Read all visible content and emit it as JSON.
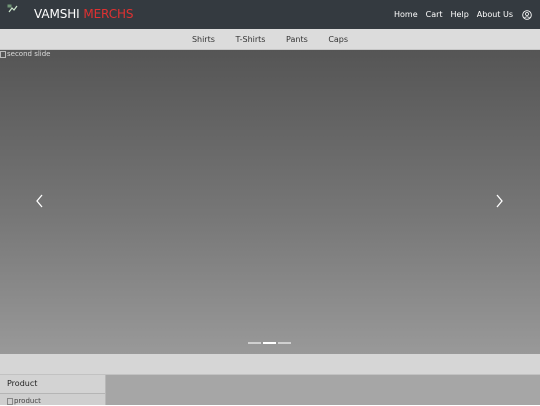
{
  "header": {
    "brand_primary": "VAMSHI",
    "brand_accent": "MERCHS",
    "nav": [
      {
        "label": "Home"
      },
      {
        "label": "Cart"
      },
      {
        "label": "Help"
      },
      {
        "label": "About Us"
      }
    ],
    "account_icon": "user-circle-icon",
    "logo_icon": "broken-image-icon"
  },
  "categories": [
    {
      "label": "Shirts"
    },
    {
      "label": "T-Shirts"
    },
    {
      "label": "Pants"
    },
    {
      "label": "Caps"
    }
  ],
  "carousel": {
    "slide_alt": "second slide",
    "active_index": 1,
    "slide_count": 3,
    "prev_icon": "chevron-left-icon",
    "next_icon": "chevron-right-icon"
  },
  "products": [
    {
      "header": "Product",
      "image_alt": "product"
    }
  ],
  "colors": {
    "navbar": "#343a40",
    "brand_accent": "#e03131"
  }
}
